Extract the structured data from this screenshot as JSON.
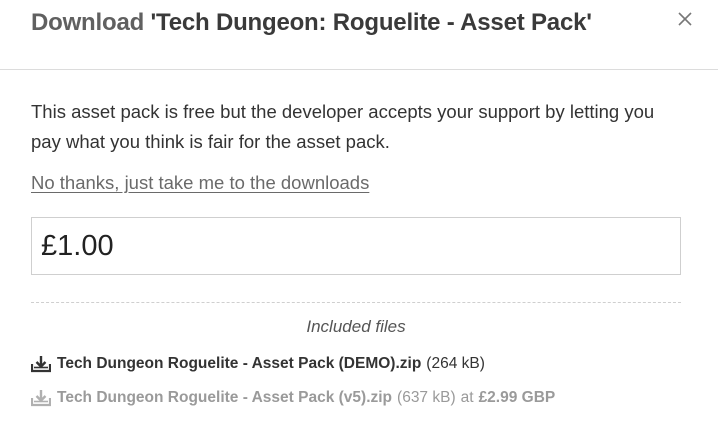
{
  "dialog": {
    "title_prefix": "Download",
    "title_name": "'Tech Dungeon: Roguelite - Asset Pack'",
    "close_icon": "close-icon"
  },
  "body": {
    "description": "This asset pack is free but the developer accepts your support by letting you pay what you think is fair for the asset pack.",
    "skip_link": "No thanks, just take me to the downloads",
    "price_value": "£1.00"
  },
  "files": {
    "title": "Included files",
    "items": [
      {
        "name": "Tech Dungeon Roguelite - Asset Pack (DEMO).zip",
        "size": "(264 kB)",
        "icon": "download-icon"
      },
      {
        "name": "Tech Dungeon Roguelite - Asset Pack (v5).zip",
        "size": "(637 kB)",
        "at": "at",
        "price": "£2.99 GBP",
        "icon": "download-icon"
      }
    ]
  },
  "colors": {
    "text": "#333333",
    "muted": "#9a9a9a",
    "link": "#6a6a6a",
    "border": "#cfcfcf"
  }
}
